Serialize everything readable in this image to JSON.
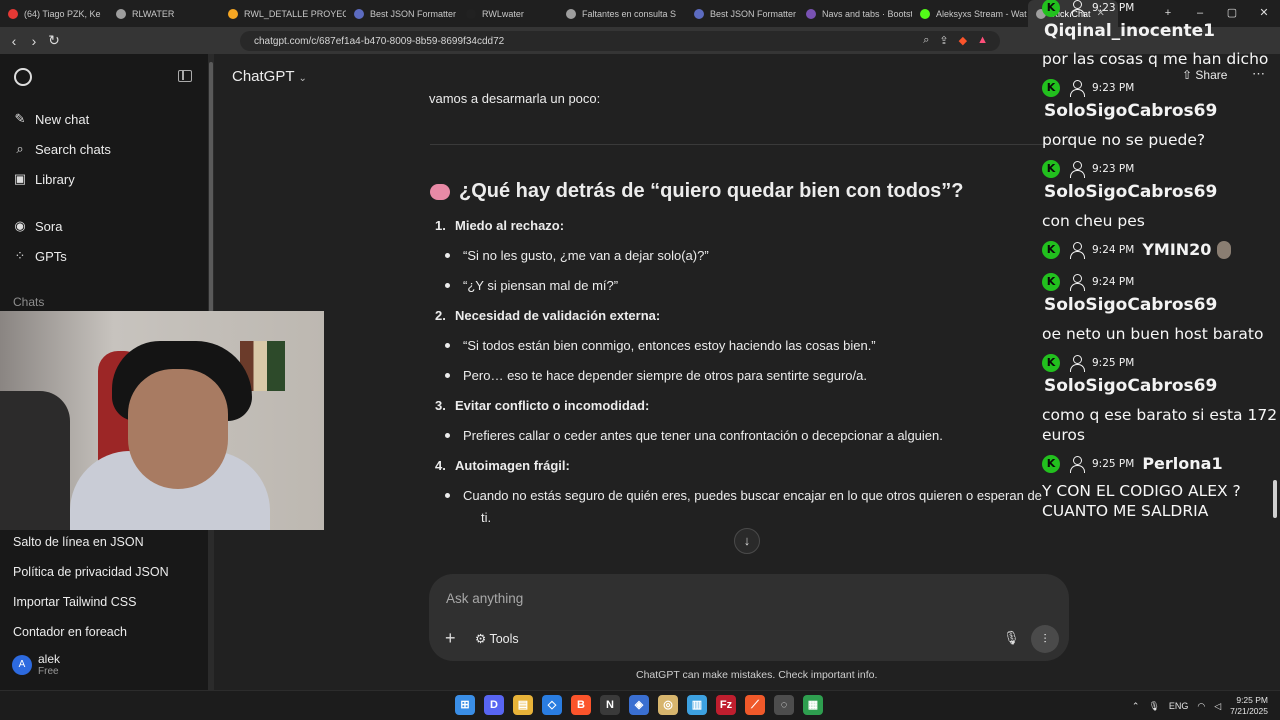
{
  "browser": {
    "tabs": [
      {
        "label": "(64) Tiago PZK, Ke",
        "color": "#e53935"
      },
      {
        "label": "RLWATER",
        "color": "#9e9e9e"
      },
      {
        "label": "RWL_DETALLE PROYEC",
        "color": "#f5a623"
      },
      {
        "label": "Best JSON Formatter a",
        "color": "#5c6bc0"
      },
      {
        "label": "RWLwater",
        "color": "#212121"
      },
      {
        "label": "Faltantes en consulta S",
        "color": "#9e9e9e"
      },
      {
        "label": "Best JSON Formatter a",
        "color": "#5c6bc0"
      },
      {
        "label": "Navs and tabs · Bootstr",
        "color": "#7952b3"
      },
      {
        "label": "Aleksyxs Stream - Wat",
        "color": "#53fc18"
      },
      {
        "label": "Kick Chat",
        "color": "#9e9e9e"
      }
    ],
    "url": "chatgpt.com/c/687ef1a4-b470-8009-8b59-8699f34cdd72"
  },
  "sidebar": {
    "nav": [
      {
        "label": "New chat",
        "icon": "✎"
      },
      {
        "label": "Search chats",
        "icon": "⌕"
      },
      {
        "label": "Library",
        "icon": "▣"
      },
      {
        "label": "Sora",
        "icon": "◉"
      },
      {
        "label": "GPTs",
        "icon": "⁘"
      }
    ],
    "section": "Chats",
    "chats": [
      "Salto de línea en JSON",
      "Política de privacidad JSON",
      "Importar Tailwind CSS",
      "Contador en foreach"
    ],
    "user": {
      "initial": "A",
      "name": "alek",
      "plan": "Free"
    }
  },
  "main": {
    "model": "ChatGPT",
    "share": "Share",
    "prev_line": "vamos a desarmarla un poco:",
    "heading": "¿Qué hay detrás de “quiero quedar bien con todos”?",
    "sections": [
      {
        "num": "1.",
        "title": "Miedo al rechazo:",
        "bullets": [
          "“Si no les gusto, ¿me van a dejar solo(a)?”",
          "“¿Y si piensan mal de mí?”"
        ]
      },
      {
        "num": "2.",
        "title": "Necesidad de validación externa:",
        "bullets": [
          "“Si todos están bien conmigo, entonces estoy haciendo las cosas bien.”",
          "Pero… eso te hace depender siempre de otros para sentirte seguro/a."
        ]
      },
      {
        "num": "3.",
        "title": "Evitar conflicto o incomodidad:",
        "bullets": [
          "Prefieres callar o ceder antes que tener una confrontación o decepcionar a alguien."
        ]
      },
      {
        "num": "4.",
        "title": "Autoimagen frágil:",
        "bullets": [
          "Cuando no estás seguro de quién eres, puedes buscar encajar en lo que otros quieren o esperan de",
          "ti."
        ]
      }
    ],
    "composer": {
      "placeholder": "Ask anything",
      "tools": "Tools"
    },
    "disclaimer": "ChatGPT can make mistakes. Check important info."
  },
  "stream_chat": {
    "top": {
      "time": "9:23 PM",
      "user": "Qiqinal_inocente1",
      "message": "por las cosas q me han dicho"
    },
    "messages": [
      {
        "time": "9:23 PM",
        "user": "SoloSigoCabros69",
        "message": "porque no se puede?"
      },
      {
        "time": "9:23 PM",
        "user": "SoloSigoCabros69",
        "message": "con cheu pes"
      },
      {
        "time": "9:24 PM",
        "user": "YMIN20",
        "message": ""
      },
      {
        "time": "9:24 PM",
        "user": "SoloSigoCabros69",
        "message": "oe neto un buen host barato"
      },
      {
        "time": "9:25 PM",
        "user": "SoloSigoCabros69",
        "message": "como q ese barato si esta 172 euros"
      },
      {
        "time": "9:25 PM",
        "user": "Perlona1",
        "message": "Y CON EL CODIGO ALEX ? CUANTO ME SALDRIA"
      }
    ],
    "kick_glyph": "K"
  },
  "taskbar": {
    "language": "ENG",
    "time": "9:25 PM",
    "date": "7/21/2025",
    "apps": [
      {
        "glyph": "⊞",
        "color": "#3a8ee6"
      },
      {
        "glyph": "D",
        "color": "#5865f2"
      },
      {
        "glyph": "▤",
        "color": "#e8b339"
      },
      {
        "glyph": "◇",
        "color": "#2a7de1"
      },
      {
        "glyph": "B",
        "color": "#fb542b"
      },
      {
        "glyph": "N",
        "color": "#3a3a3a"
      },
      {
        "glyph": "◈",
        "color": "#3a6fd1"
      },
      {
        "glyph": "◎",
        "color": "#d7b56d"
      },
      {
        "glyph": "▥",
        "color": "#3da1e0"
      },
      {
        "glyph": "Fz",
        "color": "#bf1e2e"
      },
      {
        "glyph": "⟋",
        "color": "#f0592a"
      },
      {
        "glyph": "◌",
        "color": "#4d4d4d"
      },
      {
        "glyph": "▦",
        "color": "#2e9e4f"
      }
    ]
  }
}
